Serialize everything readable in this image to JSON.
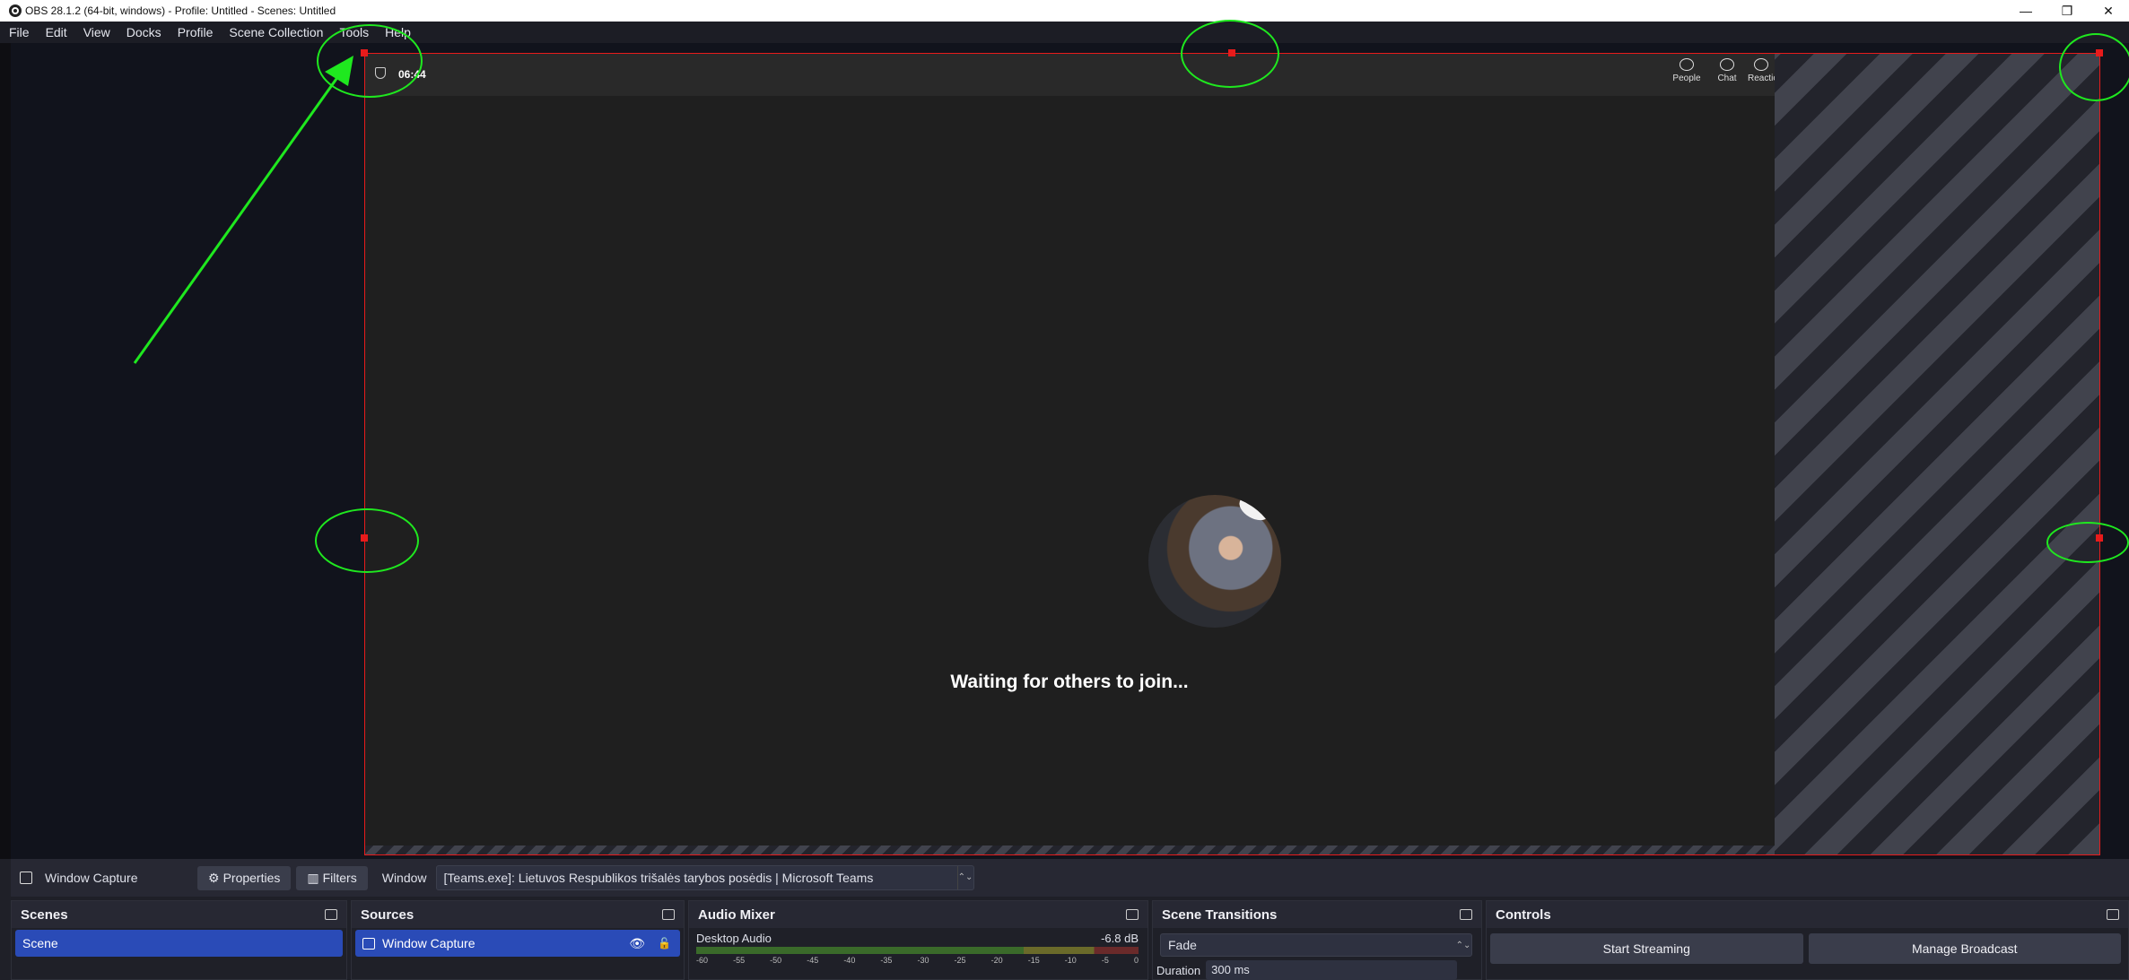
{
  "window": {
    "title": "OBS 28.1.2 (64-bit, windows) - Profile: Untitled - Scenes: Untitled",
    "min_glyph": "—",
    "restore_glyph": "❐",
    "close_glyph": "✕"
  },
  "menu": [
    "File",
    "Edit",
    "View",
    "Docks",
    "Profile",
    "Scene Collection",
    "Tools",
    "Help"
  ],
  "teams": {
    "timer": "06:44",
    "icons": [
      {
        "label": "People",
        "icon": "people-icon"
      },
      {
        "label": "Chat",
        "icon": "chat-icon"
      },
      {
        "label": "Reaction",
        "icon": "reaction-icon"
      }
    ],
    "waiting_text": "Waiting for others to join..."
  },
  "source_toolbar": {
    "source_name": "Window Capture",
    "properties_label": "Properties",
    "filters_label": "Filters",
    "window_label": "Window",
    "window_value": "[Teams.exe]: Lietuvos Respublikos trišalės tarybos posėdis | Microsoft Teams",
    "gear_glyph": "⚙",
    "filter_glyph": "▥",
    "dropdown_glyph": "⌃⌄"
  },
  "docks": {
    "scenes": {
      "title": "Scenes",
      "items": [
        "Scene"
      ]
    },
    "sources": {
      "title": "Sources",
      "items": [
        "Window Capture"
      ],
      "eye_glyph": "👁",
      "lock_glyph": "🔓"
    },
    "audio": {
      "title": "Audio Mixer",
      "channel": "Desktop Audio",
      "level": "-6.8 dB",
      "ticks": [
        "-60",
        "-55",
        "-50",
        "-45",
        "-40",
        "-35",
        "-30",
        "-25",
        "-20",
        "-15",
        "-10",
        "-5",
        "0"
      ]
    },
    "transitions": {
      "title": "Scene Transitions",
      "transition": "Fade",
      "duration_label": "Duration",
      "duration_value": "300 ms",
      "dropdown_glyph": "⌃⌄"
    },
    "controls": {
      "title": "Controls",
      "start_streaming": "Start Streaming",
      "manage_broadcast": "Manage Broadcast"
    }
  },
  "colors": {
    "selection_border": "#e81b1b",
    "annotation": "#1fe81f",
    "selected_item": "#2a4bb7"
  }
}
